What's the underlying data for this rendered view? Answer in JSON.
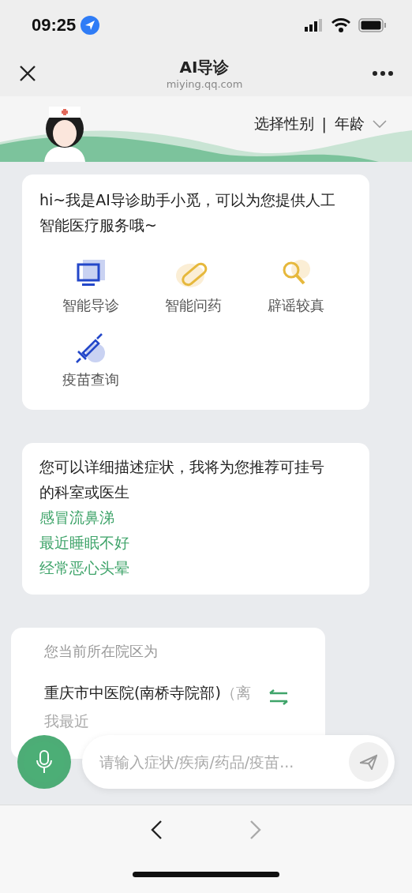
{
  "status_bar": {
    "time": "09:25"
  },
  "nav": {
    "title": "AI导诊",
    "subtitle": "miying.qq.com"
  },
  "profile_selector": {
    "gender": "选择性别",
    "separator": "|",
    "age": "年龄"
  },
  "messages": [
    {
      "kind": "menu",
      "text": "hi~我是AI导诊助手小觅，可以为您提供人工智能医疗服务哦~",
      "items": [
        "智能导诊",
        "智能问药",
        "辟谣较真",
        "疫苗查询"
      ]
    },
    {
      "kind": "suggestions",
      "text": "您可以详细描述症状，我将为您推荐可挂号的科室或医生",
      "suggestions": [
        "感冒流鼻涕",
        "最近睡眠不好",
        "经常恶心头晕"
      ]
    },
    {
      "kind": "location",
      "label": "您当前所在院区为",
      "hospital": "重庆市中医院(南桥寺院部)",
      "note": "（离我最近"
    }
  ],
  "input": {
    "placeholder": "请输入症状/疾病/药品/疫苗..."
  }
}
